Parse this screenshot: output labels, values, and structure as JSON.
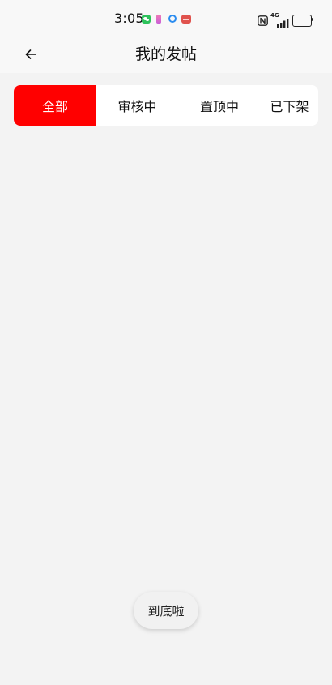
{
  "status_bar": {
    "time": "3:05",
    "notification_icons": [
      "wechat-icon",
      "pink-app-icon",
      "blue-ring-app-icon",
      "red-app-icon"
    ],
    "nfc_icon": "nfc-icon",
    "network_type": "4G",
    "signal_icon": "signal-icon",
    "battery_icon": "battery-icon",
    "battery_level": 0.25
  },
  "header": {
    "back_icon": "arrow-left-icon",
    "title": "我的发帖"
  },
  "tabs": [
    {
      "label": "全部",
      "active": true
    },
    {
      "label": "审核中",
      "active": false
    },
    {
      "label": "置顶中",
      "active": false
    },
    {
      "label": "已下架",
      "active": false
    }
  ],
  "footer": {
    "end_of_list_label": "到底啦"
  },
  "colors": {
    "accent": "#ff0000",
    "page_background": "#f3f3f3",
    "card_background": "#ffffff"
  }
}
